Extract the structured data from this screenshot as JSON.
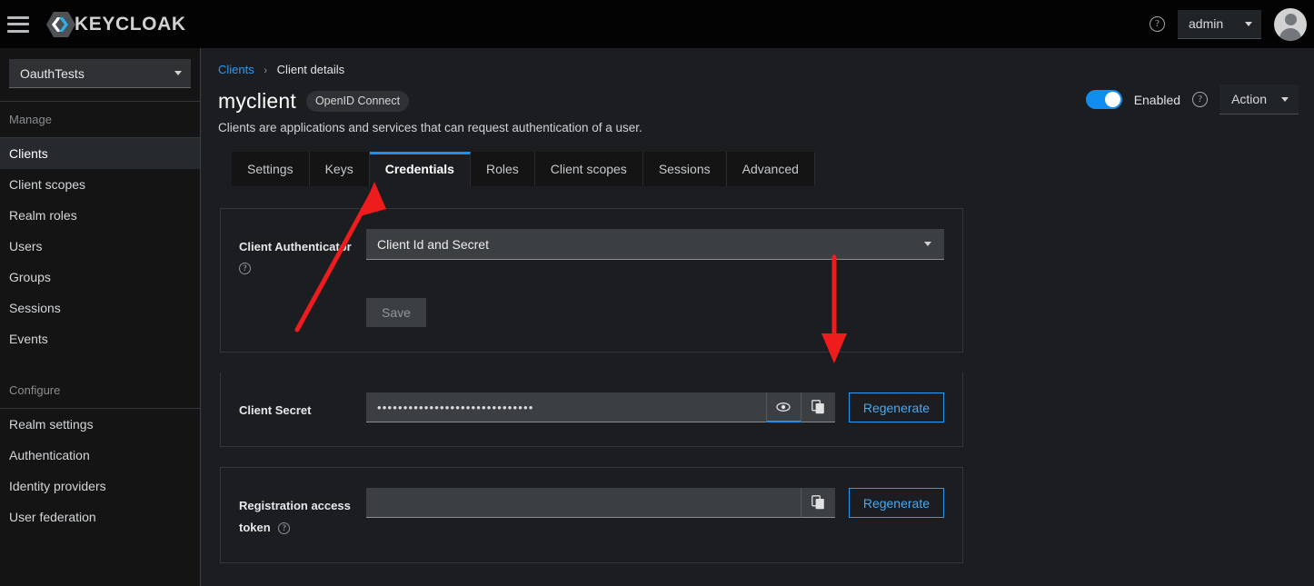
{
  "masthead": {
    "menu_icon": "hamburger-icon",
    "brand": "KEYCLOAK",
    "help_icon": "help-circle-icon",
    "user_menu": "admin",
    "avatar_icon": "user-avatar-icon"
  },
  "sidebar": {
    "realm": "OauthTests",
    "groups": [
      {
        "title": "Manage",
        "items": [
          {
            "label": "Clients",
            "active": true
          },
          {
            "label": "Client scopes",
            "active": false
          },
          {
            "label": "Realm roles",
            "active": false
          },
          {
            "label": "Users",
            "active": false
          },
          {
            "label": "Groups",
            "active": false
          },
          {
            "label": "Sessions",
            "active": false
          },
          {
            "label": "Events",
            "active": false
          }
        ]
      },
      {
        "title": "Configure",
        "items": [
          {
            "label": "Realm settings",
            "active": false
          },
          {
            "label": "Authentication",
            "active": false
          },
          {
            "label": "Identity providers",
            "active": false
          },
          {
            "label": "User federation",
            "active": false
          }
        ]
      }
    ]
  },
  "breadcrumb": {
    "parent": "Clients",
    "separator": "›",
    "current": "Client details"
  },
  "header": {
    "title": "myclient",
    "protocol_chip": "OpenID Connect",
    "description": "Clients are applications and services that can request authentication of a user.",
    "enabled_label": "Enabled",
    "enabled_state": "on",
    "help_icon": "help-circle-icon",
    "action_label": "Action"
  },
  "tabs": [
    {
      "label": "Settings",
      "active": false
    },
    {
      "label": "Keys",
      "active": false
    },
    {
      "label": "Credentials",
      "active": true
    },
    {
      "label": "Roles",
      "active": false
    },
    {
      "label": "Client scopes",
      "active": false
    },
    {
      "label": "Sessions",
      "active": false
    },
    {
      "label": "Advanced",
      "active": false
    }
  ],
  "authenticator": {
    "label": "Client Authenticator",
    "help_icon": "help-circle-icon",
    "selected": "Client Id and Secret",
    "save_label": "Save"
  },
  "client_secret": {
    "label": "Client Secret",
    "value": "••••••••••••••••••••••••••••••",
    "show_icon": "eye-icon",
    "copy_icon": "copy-icon",
    "regenerate_label": "Regenerate"
  },
  "registration_token": {
    "label_line1": "Registration access",
    "label_line2": "token",
    "help_icon": "help-circle-icon",
    "value": "",
    "copy_icon": "copy-icon",
    "regenerate_label": "Regenerate"
  },
  "annotations": {
    "color": "#ee1c1c",
    "arrow1": "arrow pointing to Credentials tab",
    "arrow2": "arrow pointing to client secret copy button"
  }
}
